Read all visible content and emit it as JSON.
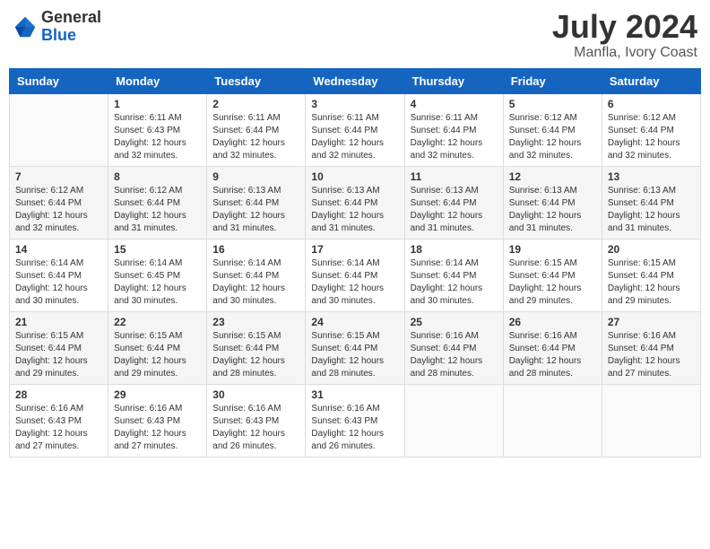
{
  "header": {
    "logo_general": "General",
    "logo_blue": "Blue",
    "month_year": "July 2024",
    "location": "Manfla, Ivory Coast"
  },
  "calendar": {
    "days_of_week": [
      "Sunday",
      "Monday",
      "Tuesday",
      "Wednesday",
      "Thursday",
      "Friday",
      "Saturday"
    ],
    "weeks": [
      [
        {
          "day": "",
          "info": ""
        },
        {
          "day": "1",
          "info": "Sunrise: 6:11 AM\nSunset: 6:43 PM\nDaylight: 12 hours\nand 32 minutes."
        },
        {
          "day": "2",
          "info": "Sunrise: 6:11 AM\nSunset: 6:44 PM\nDaylight: 12 hours\nand 32 minutes."
        },
        {
          "day": "3",
          "info": "Sunrise: 6:11 AM\nSunset: 6:44 PM\nDaylight: 12 hours\nand 32 minutes."
        },
        {
          "day": "4",
          "info": "Sunrise: 6:11 AM\nSunset: 6:44 PM\nDaylight: 12 hours\nand 32 minutes."
        },
        {
          "day": "5",
          "info": "Sunrise: 6:12 AM\nSunset: 6:44 PM\nDaylight: 12 hours\nand 32 minutes."
        },
        {
          "day": "6",
          "info": "Sunrise: 6:12 AM\nSunset: 6:44 PM\nDaylight: 12 hours\nand 32 minutes."
        }
      ],
      [
        {
          "day": "7",
          "info": "Sunrise: 6:12 AM\nSunset: 6:44 PM\nDaylight: 12 hours\nand 32 minutes."
        },
        {
          "day": "8",
          "info": "Sunrise: 6:12 AM\nSunset: 6:44 PM\nDaylight: 12 hours\nand 31 minutes."
        },
        {
          "day": "9",
          "info": "Sunrise: 6:13 AM\nSunset: 6:44 PM\nDaylight: 12 hours\nand 31 minutes."
        },
        {
          "day": "10",
          "info": "Sunrise: 6:13 AM\nSunset: 6:44 PM\nDaylight: 12 hours\nand 31 minutes."
        },
        {
          "day": "11",
          "info": "Sunrise: 6:13 AM\nSunset: 6:44 PM\nDaylight: 12 hours\nand 31 minutes."
        },
        {
          "day": "12",
          "info": "Sunrise: 6:13 AM\nSunset: 6:44 PM\nDaylight: 12 hours\nand 31 minutes."
        },
        {
          "day": "13",
          "info": "Sunrise: 6:13 AM\nSunset: 6:44 PM\nDaylight: 12 hours\nand 31 minutes."
        }
      ],
      [
        {
          "day": "14",
          "info": "Sunrise: 6:14 AM\nSunset: 6:44 PM\nDaylight: 12 hours\nand 30 minutes."
        },
        {
          "day": "15",
          "info": "Sunrise: 6:14 AM\nSunset: 6:45 PM\nDaylight: 12 hours\nand 30 minutes."
        },
        {
          "day": "16",
          "info": "Sunrise: 6:14 AM\nSunset: 6:44 PM\nDaylight: 12 hours\nand 30 minutes."
        },
        {
          "day": "17",
          "info": "Sunrise: 6:14 AM\nSunset: 6:44 PM\nDaylight: 12 hours\nand 30 minutes."
        },
        {
          "day": "18",
          "info": "Sunrise: 6:14 AM\nSunset: 6:44 PM\nDaylight: 12 hours\nand 30 minutes."
        },
        {
          "day": "19",
          "info": "Sunrise: 6:15 AM\nSunset: 6:44 PM\nDaylight: 12 hours\nand 29 minutes."
        },
        {
          "day": "20",
          "info": "Sunrise: 6:15 AM\nSunset: 6:44 PM\nDaylight: 12 hours\nand 29 minutes."
        }
      ],
      [
        {
          "day": "21",
          "info": "Sunrise: 6:15 AM\nSunset: 6:44 PM\nDaylight: 12 hours\nand 29 minutes."
        },
        {
          "day": "22",
          "info": "Sunrise: 6:15 AM\nSunset: 6:44 PM\nDaylight: 12 hours\nand 29 minutes."
        },
        {
          "day": "23",
          "info": "Sunrise: 6:15 AM\nSunset: 6:44 PM\nDaylight: 12 hours\nand 28 minutes."
        },
        {
          "day": "24",
          "info": "Sunrise: 6:15 AM\nSunset: 6:44 PM\nDaylight: 12 hours\nand 28 minutes."
        },
        {
          "day": "25",
          "info": "Sunrise: 6:16 AM\nSunset: 6:44 PM\nDaylight: 12 hours\nand 28 minutes."
        },
        {
          "day": "26",
          "info": "Sunrise: 6:16 AM\nSunset: 6:44 PM\nDaylight: 12 hours\nand 28 minutes."
        },
        {
          "day": "27",
          "info": "Sunrise: 6:16 AM\nSunset: 6:44 PM\nDaylight: 12 hours\nand 27 minutes."
        }
      ],
      [
        {
          "day": "28",
          "info": "Sunrise: 6:16 AM\nSunset: 6:43 PM\nDaylight: 12 hours\nand 27 minutes."
        },
        {
          "day": "29",
          "info": "Sunrise: 6:16 AM\nSunset: 6:43 PM\nDaylight: 12 hours\nand 27 minutes."
        },
        {
          "day": "30",
          "info": "Sunrise: 6:16 AM\nSunset: 6:43 PM\nDaylight: 12 hours\nand 26 minutes."
        },
        {
          "day": "31",
          "info": "Sunrise: 6:16 AM\nSunset: 6:43 PM\nDaylight: 12 hours\nand 26 minutes."
        },
        {
          "day": "",
          "info": ""
        },
        {
          "day": "",
          "info": ""
        },
        {
          "day": "",
          "info": ""
        }
      ]
    ]
  }
}
